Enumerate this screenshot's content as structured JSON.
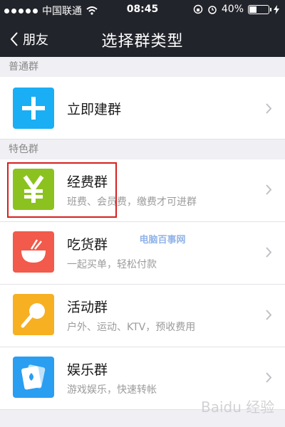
{
  "status_bar": {
    "carrier": "中国联通",
    "time": "08:45",
    "battery_percent": "40%"
  },
  "nav": {
    "back_label": "朋友",
    "title": "选择群类型"
  },
  "sections": [
    {
      "header": "普通群",
      "items": [
        {
          "title": "立即建群",
          "subtitle": "",
          "icon": "plus-icon",
          "color": "#1aaef4"
        }
      ]
    },
    {
      "header": "特色群",
      "items": [
        {
          "title": "经费群",
          "subtitle": "班费、会员费，缴费才可进群",
          "icon": "yen-icon",
          "color": "#8cc21f"
        },
        {
          "title": "吃货群",
          "subtitle": "一起买单，轻松付款",
          "icon": "bowl-icon",
          "color": "#f25a4b"
        },
        {
          "title": "活动群",
          "subtitle": "户外、运动、KTV，预收费用",
          "icon": "ping-pong-icon",
          "color": "#f6b021"
        },
        {
          "title": "娱乐群",
          "subtitle": "游戏娱乐，快速转帐",
          "icon": "cards-icon",
          "color": "#2a9ef0"
        }
      ]
    }
  ],
  "watermark": "电脑百事网",
  "watermark_logo": "Baidu 经验"
}
